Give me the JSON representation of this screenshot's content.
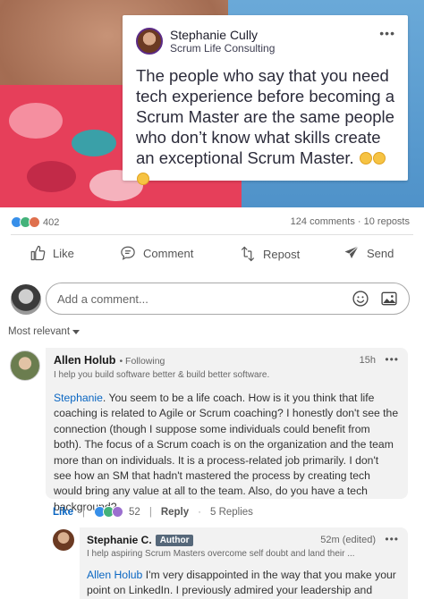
{
  "post": {
    "quote_card": {
      "author_name": "Stephanie Cully",
      "author_org": "Scrum Life Consulting",
      "quote": "The people who say that you need tech experience before becoming a Scrum Master are the same people who don’t know what skills create an exceptional Scrum Master.",
      "emojis": [
        "upside-down-face-emoji",
        "upside-down-face-emoji",
        "upside-down-face-emoji"
      ]
    },
    "reaction_count": "402",
    "comments_count": "124 comments",
    "separator": "·",
    "reposts_count": "10 reposts",
    "actions": {
      "like": "Like",
      "comment": "Comment",
      "repost": "Repost",
      "send": "Send"
    }
  },
  "comment_box": {
    "placeholder": "Add a comment..."
  },
  "sort": {
    "label": "Most relevant"
  },
  "comments": [
    {
      "author": "Allen Holub",
      "follow_status": "• Following",
      "time": "15h",
      "headline": "I help you build software better & build better software.",
      "mention": "Stephanie",
      "text": ". You seem to be a life coach. How is it you think that life coaching is related to Agile or Scrum coaching? I honestly don't see the connection (though I suppose some individuals could benefit from both). The focus of a Scrum coach is on the organization and the team more than on individuals. It is a process-related job primarily. I don't see how an SM that hadn't mastered the process by creating tech would bring any value at all to the team. Also, do you have a tech background?",
      "like_label": "Like",
      "reaction_count": "52",
      "reply_label": "Reply",
      "replies_label": "5 Replies"
    }
  ],
  "reply": {
    "author": "Stephanie C.",
    "badge": "Author",
    "time": "52m (edited)",
    "headline": "I help aspiring Scrum Masters overcome self doubt and land their ...",
    "mention": "Allen Holub",
    "text": " I'm very disappointed in the way that you make your point on LinkedIn. I previously admired your leadership and"
  },
  "colors": {
    "link_blue": "#0a66c2",
    "author_badge": "#56687a",
    "bubble_bg": "#f2f2f2",
    "hero_sky": "#5a9bd0"
  }
}
